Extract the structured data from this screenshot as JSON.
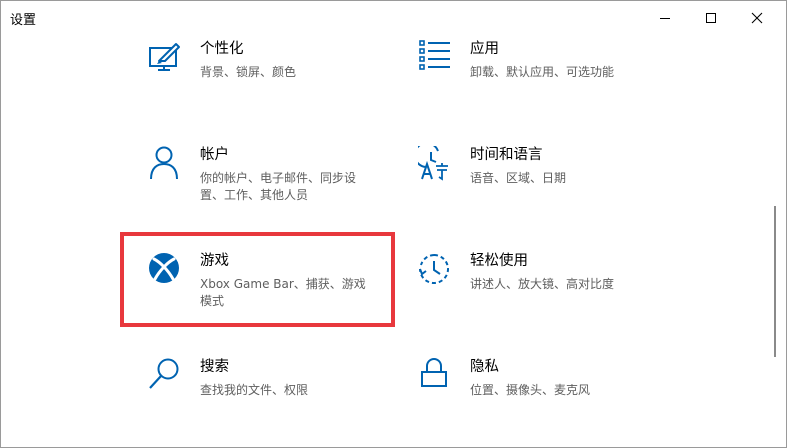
{
  "window": {
    "title": "设置",
    "controls": {
      "minimize": "minimize",
      "maximize": "maximize",
      "close": "close"
    }
  },
  "accent_color": "#0063b1",
  "highlight_color": "#e8383d",
  "tiles": [
    {
      "id": "personalization",
      "title": "个性化",
      "desc": "背景、锁屏、颜色",
      "icon": "personalization-icon"
    },
    {
      "id": "apps",
      "title": "应用",
      "desc": "卸载、默认应用、可选功能",
      "icon": "apps-list-icon"
    },
    {
      "id": "accounts",
      "title": "帐户",
      "desc": "你的帐户、电子邮件、同步设置、工作、其他人员",
      "icon": "person-icon"
    },
    {
      "id": "time-language",
      "title": "时间和语言",
      "desc": "语音、区域、日期",
      "icon": "time-language-icon"
    },
    {
      "id": "gaming",
      "title": "游戏",
      "desc": "Xbox Game Bar、捕获、游戏模式",
      "icon": "xbox-icon"
    },
    {
      "id": "ease-of-access",
      "title": "轻松使用",
      "desc": "讲述人、放大镜、高对比度",
      "icon": "ease-of-access-icon"
    },
    {
      "id": "search",
      "title": "搜索",
      "desc": "查找我的文件、权限",
      "icon": "search-icon"
    },
    {
      "id": "privacy",
      "title": "隐私",
      "desc": "位置、摄像头、麦克风",
      "icon": "lock-icon"
    }
  ]
}
